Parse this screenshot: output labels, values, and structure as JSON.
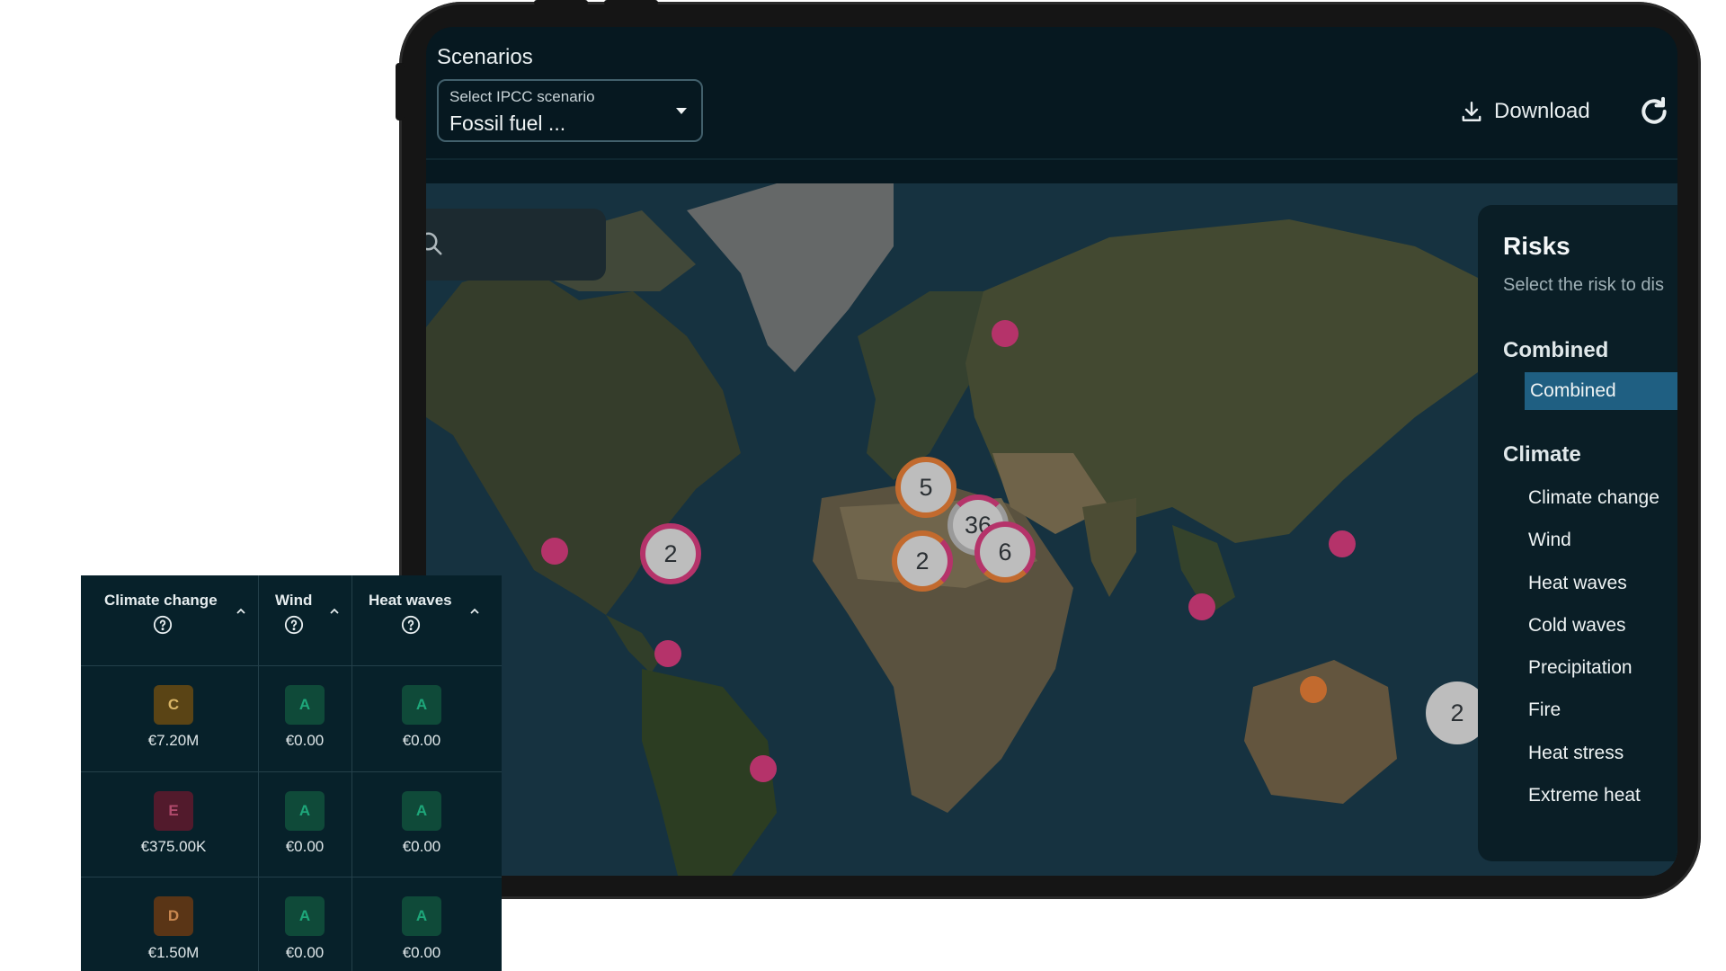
{
  "header": {
    "title": "Scenarios",
    "scenario_select": {
      "label": "Select IPCC scenario",
      "value": "Fossil fuel ..."
    },
    "download_label": "Download"
  },
  "map": {
    "clusters": [
      "2",
      "5",
      "36",
      "2",
      "6",
      "2"
    ]
  },
  "risks_panel": {
    "title": "Risks",
    "subtitle": "Select the risk to dis",
    "groups": [
      {
        "label": "Combined",
        "items": [
          "Combined"
        ],
        "selected": "Combined"
      },
      {
        "label": "Climate",
        "items": [
          "Climate change",
          "Wind",
          "Heat waves",
          "Cold waves",
          "Precipitation",
          "Fire",
          "Heat stress",
          "Extreme heat"
        ]
      }
    ]
  },
  "table": {
    "columns": [
      "Climate change",
      "Wind",
      "Heat waves"
    ],
    "rows": [
      {
        "cells": [
          {
            "grade": "C",
            "amount": "€7.20M"
          },
          {
            "grade": "A",
            "amount": "€0.00"
          },
          {
            "grade": "A",
            "amount": "€0.00"
          }
        ]
      },
      {
        "cells": [
          {
            "grade": "E",
            "amount": "€375.00K"
          },
          {
            "grade": "A",
            "amount": "€0.00"
          },
          {
            "grade": "A",
            "amount": "€0.00"
          }
        ]
      },
      {
        "cells": [
          {
            "grade": "D",
            "amount": "€1.50M"
          },
          {
            "grade": "A",
            "amount": "€0.00"
          },
          {
            "grade": "A",
            "amount": "€0.00"
          }
        ]
      }
    ]
  }
}
